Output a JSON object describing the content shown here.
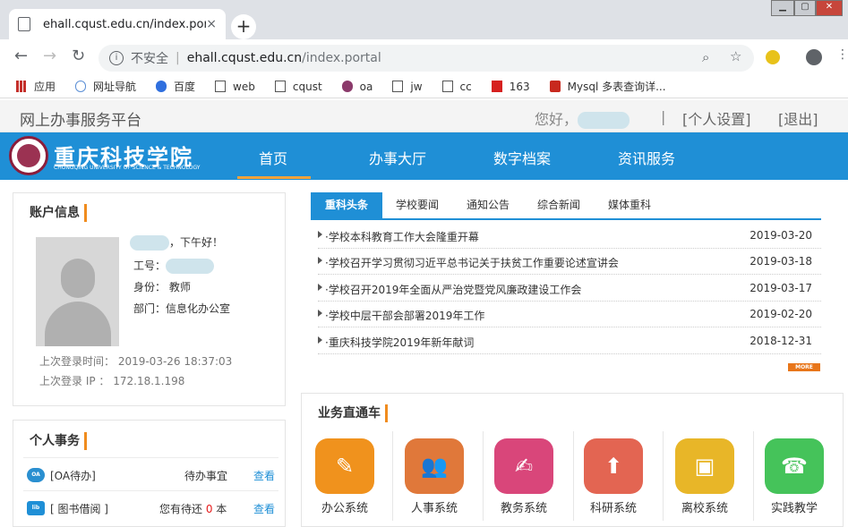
{
  "browser": {
    "tab_title": "ehall.cqust.edu.cn/index.portal",
    "tab_close": "×",
    "new_tab": "+",
    "url_security": "不安全",
    "url_domain": "ehall.cqust.edu.cn",
    "url_path": "/index.portal"
  },
  "bookmarks": [
    {
      "label": "应用",
      "icon": "apps-icon"
    },
    {
      "label": "网址导航",
      "icon": "globe-icon"
    },
    {
      "label": "百度",
      "icon": "baidu-icon"
    },
    {
      "label": "web",
      "icon": "page-icon"
    },
    {
      "label": "cqust",
      "icon": "page-icon"
    },
    {
      "label": "oa",
      "icon": "oa-icon"
    },
    {
      "label": "jw",
      "icon": "page-icon"
    },
    {
      "label": "cc",
      "icon": "page-icon"
    },
    {
      "label": "163",
      "icon": "netease-icon"
    },
    {
      "label": "Mysql 多表查询详...",
      "icon": "csdn-icon"
    }
  ],
  "header": {
    "platform": "网上办事服务平台",
    "greeting": "您好，",
    "separator": "|",
    "settings": "[个人设置]",
    "logout": "[退出]"
  },
  "logo": {
    "text": "重庆科技学院",
    "sub": "CHONGQING UNIVERSITY OF SCIENCE & TECHNOLOGY"
  },
  "nav": [
    "首页",
    "办事大厅",
    "数字档案",
    "资讯服务"
  ],
  "account": {
    "title": "账户信息",
    "greeting_suffix": "，下午好！",
    "id_label": "工号：",
    "role": "身份： 教师",
    "dept": "部门：信息化办公室",
    "last_time": "上次登录时间： 2019-03-26 18:37:03",
    "last_ip": "上次登录 IP ： 172.18.1.198"
  },
  "news": {
    "tabs": [
      "重科头条",
      "学校要闻",
      "通知公告",
      "综合新闻",
      "媒体重科"
    ],
    "items": [
      {
        "title": "·学校本科教育工作大会隆重开幕",
        "date": "2019-03-20"
      },
      {
        "title": "·学校召开学习贯彻习近平总书记关于扶贫工作重要论述宣讲会",
        "date": "2019-03-18"
      },
      {
        "title": "·学校召开2019年全面从严治党暨党风廉政建设工作会",
        "date": "2019-03-17"
      },
      {
        "title": "·学校中层干部会部署2019年工作",
        "date": "2019-02-20"
      },
      {
        "title": "·重庆科技学院2019年新年献词",
        "date": "2018-12-31"
      }
    ],
    "more": "MORE"
  },
  "business": {
    "title": "业务直通车",
    "items": [
      {
        "label": "办公系统",
        "color": "#f0921d"
      },
      {
        "label": "人事系统",
        "color": "#e0783a"
      },
      {
        "label": "教务系统",
        "color": "#d9467a"
      },
      {
        "label": "科研系统",
        "color": "#e36552"
      },
      {
        "label": "离校系统",
        "color": "#e8b628"
      },
      {
        "label": "实践教学",
        "color": "#45c35a"
      }
    ]
  },
  "personal": {
    "title": "个人事务",
    "items": [
      {
        "badge": "OA",
        "label": "[OA待办]",
        "status": "待办事宜",
        "link": "查看"
      },
      {
        "badge": "lib",
        "label": "[ 图书借阅 ]",
        "status_pre": "您有待还 ",
        "count": "0",
        "status_post": " 本",
        "link": "查看"
      }
    ]
  }
}
